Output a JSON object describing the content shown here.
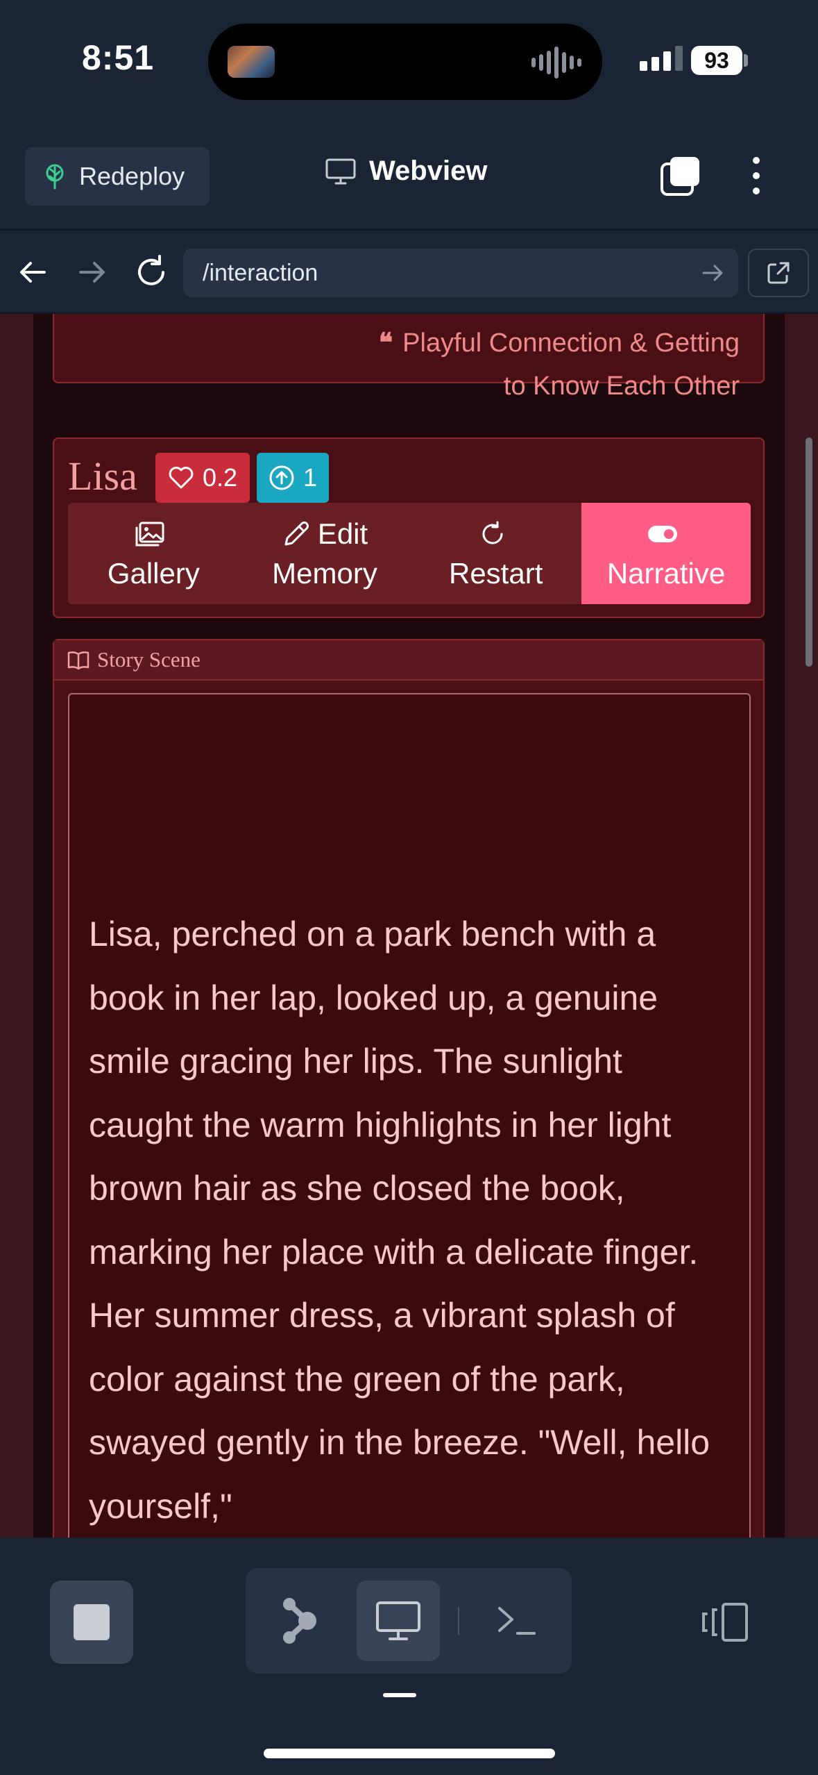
{
  "status_bar": {
    "time": "8:51",
    "battery": "93"
  },
  "toolbar": {
    "redeploy_label": "Redeploy",
    "title": "Webview"
  },
  "urlbar": {
    "url": "/interaction"
  },
  "quote": {
    "text": "Playful Connection & Getting to Know Each Other"
  },
  "character": {
    "name": "Lisa",
    "affection": "0.2",
    "level": "1",
    "actions": [
      {
        "line1": "",
        "line2": "Gallery"
      },
      {
        "line1": "Edit",
        "line2": "Memory"
      },
      {
        "line1": "",
        "line2": "Restart"
      },
      {
        "line1": "",
        "line2": "Narrative"
      }
    ]
  },
  "scene": {
    "header": "Story Scene",
    "text": "Lisa, perched on a park bench with a book in her lap, looked up, a genuine smile gracing her lips. The sunlight caught the warm highlights in her light brown hair as she closed the book, marking her place with a delicate finger. Her summer dress, a vibrant splash of color against the green of the park, swayed gently in the breeze. \"Well, hello yourself,\""
  },
  "colors": {
    "accent": "#ff5c86",
    "affection_badge": "#c92c3a",
    "level_badge": "#1aa7c2",
    "app_bg": "#1b2434"
  },
  "icons": {
    "redeploy": "tree-icon",
    "webview": "monitor-icon",
    "gallery": "image-icon",
    "edit": "pencil-icon",
    "restart": "rotate-icon",
    "narrative": "toggle-icon",
    "scene": "book-icon"
  }
}
